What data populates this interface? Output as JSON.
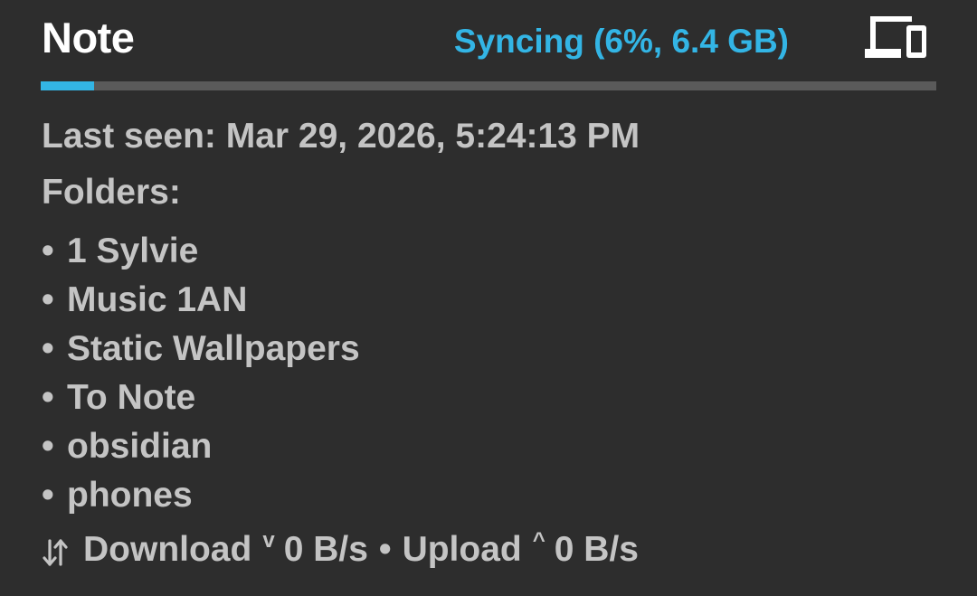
{
  "device": {
    "name": "Note",
    "sync_status": "Syncing (6%, 6.4 GB)",
    "progress_percent": 6
  },
  "last_seen": "Last seen: Mar 29, 2026, 5:24:13 PM",
  "folders": {
    "heading": "Folders:",
    "bullet": "•",
    "items": [
      {
        "label": "1 Sylvie"
      },
      {
        "label": "Music 1AN"
      },
      {
        "label": "Static Wallpapers"
      },
      {
        "label": "To Note"
      },
      {
        "label": "obsidian"
      },
      {
        "label": "phones"
      }
    ]
  },
  "transfer": {
    "icon": "swap-vertical-icon",
    "download_label": "Download",
    "download_arrow": "v",
    "download_rate": "0 B/s",
    "separator": "•",
    "upload_label": "Upload",
    "upload_arrow": "^",
    "upload_rate": "0 B/s"
  },
  "colors": {
    "background": "#2d2d2d",
    "title": "#ffffff",
    "accent": "#33b5e5",
    "text": "#c4c4c4",
    "track": "#5a5a5a"
  }
}
